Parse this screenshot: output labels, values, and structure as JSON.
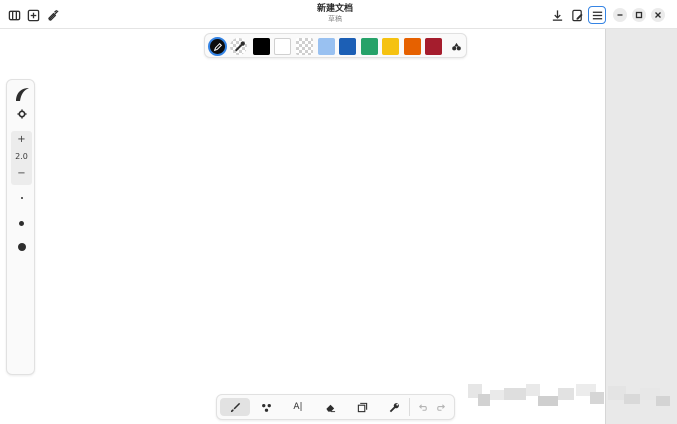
{
  "window": {
    "title": "新建文档",
    "subtitle": "草稿"
  },
  "headerbar": {
    "left_icons": [
      "sidebar-toggle-icon",
      "new-document-icon",
      "hide-tools-icon"
    ],
    "right_icons": [
      "download-icon",
      "save-as-icon",
      "menu-icon"
    ],
    "window_controls": [
      "minimize-icon",
      "maximize-icon",
      "close-icon"
    ]
  },
  "palette": {
    "active_tool": "pencil",
    "colors": [
      "#000000",
      "#ffffff",
      "transparent",
      "#99c1f1",
      "#1c5fb5",
      "#26a269",
      "#f5c211",
      "#e66100",
      "#a51d2d"
    ],
    "selected_color": "#000000"
  },
  "size": {
    "value": "2.0",
    "increase_label": "+",
    "decrease_label": "−"
  },
  "tools": {
    "text_label": "A|",
    "active": "paint"
  },
  "theme": {
    "accent": "#3584e4",
    "panel_bg": "#fafafa",
    "sidebar_bg": "#e9e9e9"
  }
}
